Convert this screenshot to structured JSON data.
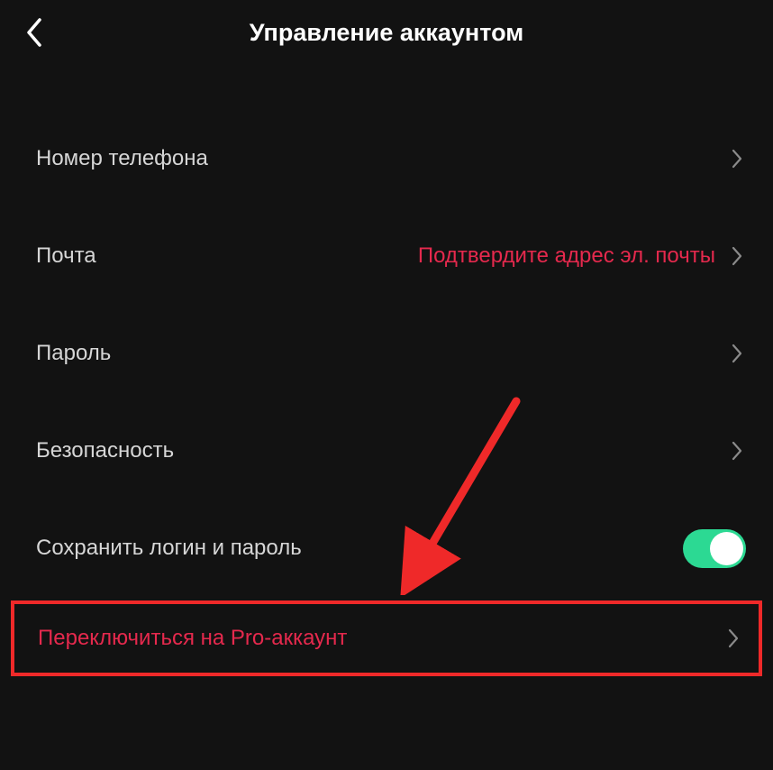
{
  "header": {
    "title": "Управление аккаунтом"
  },
  "rows": {
    "phone": {
      "label": "Номер телефона"
    },
    "email": {
      "label": "Почта",
      "value": "Подтвердите адрес эл. почты"
    },
    "password": {
      "label": "Пароль"
    },
    "security": {
      "label": "Безопасность"
    },
    "save_login": {
      "label": "Сохранить логин и пароль",
      "toggled": true
    },
    "pro": {
      "label": "Переключиться на Pro-аккаунт"
    }
  },
  "colors": {
    "accent_red": "#e5294d",
    "toggle_green": "#2cd993",
    "highlight_border": "#ef2929"
  }
}
